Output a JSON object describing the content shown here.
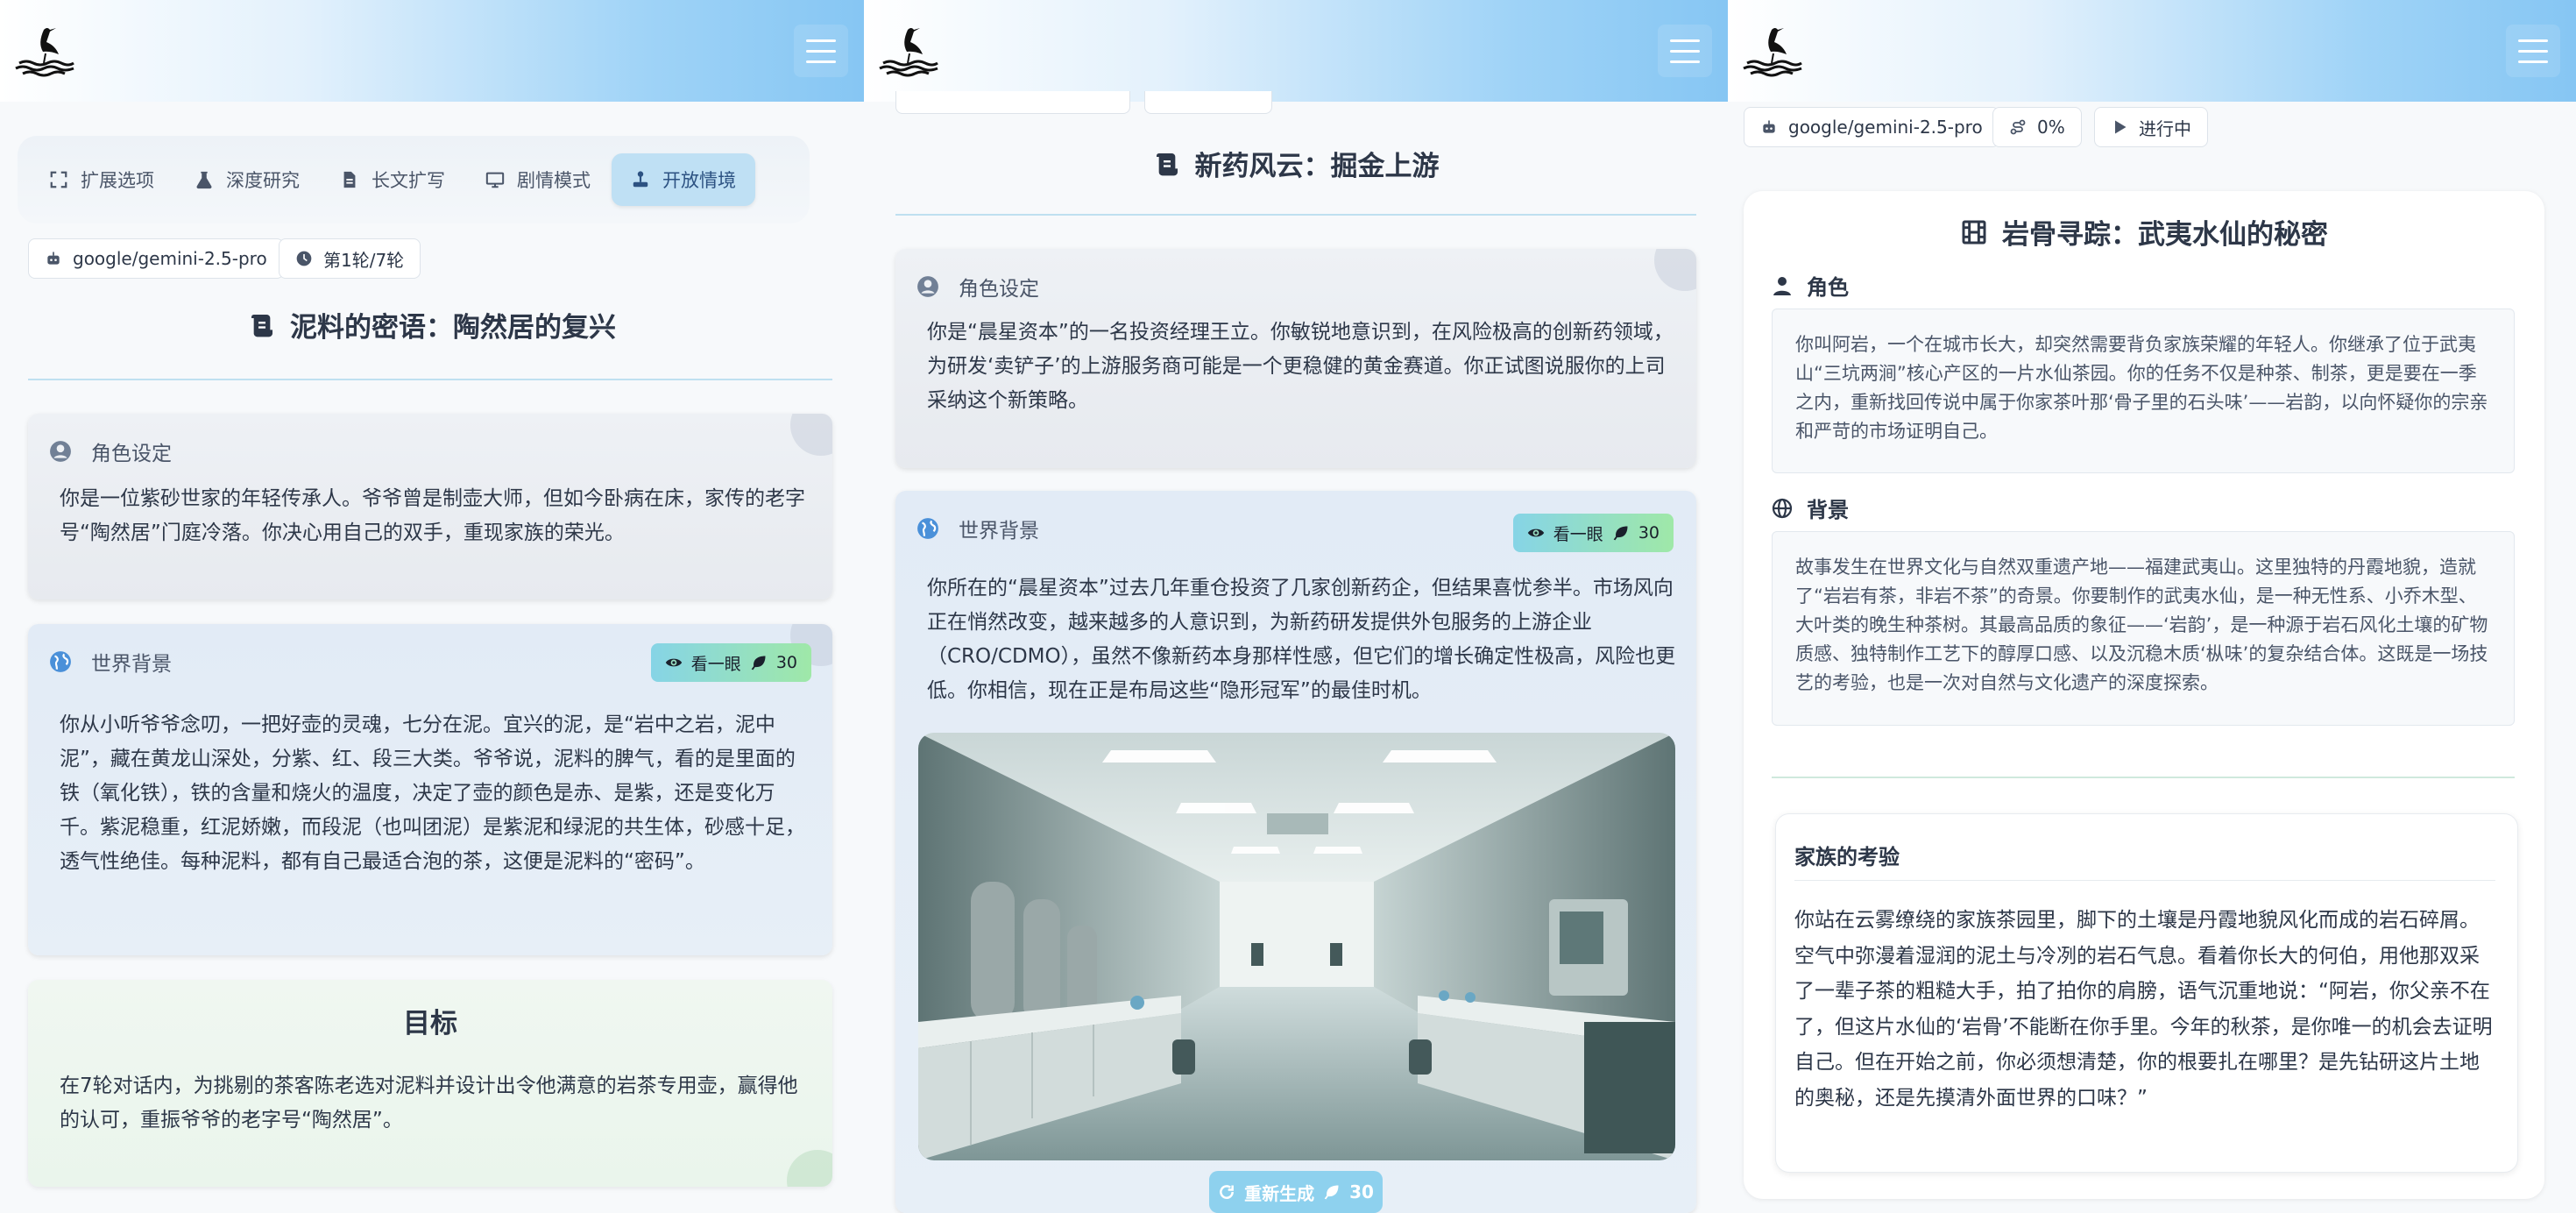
{
  "panels": [
    {
      "tabs": [
        {
          "label": "扩展选项",
          "icon": "expand-icon"
        },
        {
          "label": "深度研究",
          "icon": "flask-icon"
        },
        {
          "label": "长文扩写",
          "icon": "document-icon"
        },
        {
          "label": "剧情模式",
          "icon": "monitor-icon"
        },
        {
          "label": "开放情境",
          "icon": "joystick-icon",
          "active": true
        }
      ],
      "model": "google/gemini-2.5-pro",
      "rounds": "第1轮/7轮",
      "title": "泥料的密语：陶然居的复兴",
      "role": {
        "heading": "角色设定",
        "text": "你是一位紫砂世家的年轻传承人。爷爷曾是制壶大师，但如今卧病在床，家传的老字号“陶然居”门庭冷落。你决心用自己的双手，重现家族的荣光。"
      },
      "world": {
        "heading": "世界背景",
        "peek_label": "看一眼",
        "peek_cost": "30",
        "text": "你从小听爷爷念叨，一把好壶的灵魂，七分在泥。宜兴的泥，是“岩中之岩，泥中泥”，藏在黄龙山深处，分紫、红、段三大类。爷爷说，泥料的脾气，看的是里面的铁（氧化铁），铁的含量和烧火的温度，决定了壶的颜色是赤、是紫，还是变化万千。紫泥稳重，红泥娇嫩，而段泥（也叫团泥）是紫泥和绿泥的共生体，砂感十足，透气性绝佳。每种泥料，都有自己最适合泡的茶，这便是泥料的“密码”。"
      },
      "goal": {
        "heading": "目标",
        "text": "在7轮对话内，为挑剔的茶客陈老选对泥料并设计出令他满意的岩茶专用壶，赢得他的认可，重振爷爷的老字号“陶然居”。"
      }
    },
    {
      "title": "新药风云：掘金上游",
      "role": {
        "heading": "角色设定",
        "text": "你是“晨星资本”的一名投资经理王立。你敏锐地意识到，在风险极高的创新药领域，为研发‘卖铲子’的上游服务商可能是一个更稳健的黄金赛道。你正试图说服你的上司采纳这个新策略。"
      },
      "world": {
        "heading": "世界背景",
        "peek_label": "看一眼",
        "peek_cost": "30",
        "text": "你所在的“晨星资本”过去几年重仓投资了几家创新药企，但结果喜忧参半。市场风向正在悄然改变，越来越多的人意识到，为新药研发提供外包服务的上游企业（CRO/CDMO），虽然不像新药本身那样性感，但它们的增长确定性极高，风险也更低。你相信，现在正是布局这些“隐形冠军”的最佳时机。"
      },
      "regen_label": "重新生成",
      "regen_cost": "30"
    },
    {
      "model": "google/gemini-2.5-pro",
      "progress": "0%",
      "status": "进行中",
      "title": "岩骨寻踪：武夷水仙的秘密",
      "role": {
        "heading": "角色",
        "text": "你叫阿岩，一个在城市长大，却突然需要背负家族荣耀的年轻人。你继承了位于武夷山“三坑两涧”核心产区的一片水仙茶园。你的任务不仅是种茶、制茶，更是要在一季之内，重新找回传说中属于你家茶叶那‘骨子里的石头味’——岩韵，以向怀疑你的宗亲和严苛的市场证明自己。"
      },
      "world": {
        "heading": "背景",
        "text": "故事发生在世界文化与自然双重遗产地——福建武夷山。这里独特的丹霞地貌，造就了“岩岩有茶，非岩不茶”的奇景。你要制作的武夷水仙，是一种无性系、小乔木型、大叶类的晚生种茶树。其最高品质的象征——‘岩韵’，是一种源于岩石风化土壤的矿物质感、独特制作工艺下的醇厚口感、以及沉稳木质‘枞味’的复杂结合体。这既是一场技艺的考验，也是一次对自然与文化遗产的深度探索。"
      },
      "chapter": {
        "heading": "家族的考验",
        "text": "你站在云雾缭绕的家族茶园里，脚下的土壤是丹霞地貌风化而成的岩石碎屑。空气中弥漫着湿润的泥土与冷冽的岩石气息。看着你长大的何伯，用他那双采了一辈子茶的粗糙大手，拍了拍你的肩膀，语气沉重地说：“阿岩，你父亲不在了，但这片水仙的‘岩骨’不能断在你手里。今年的秋茶，是你唯一的机会去证明自己。但在开始之前，你必须想清楚，你的根要扎在哪里？是先钻研这片土地的奥秘，还是先摸清外面世界的口味？”"
      }
    }
  ],
  "colors": {
    "topbar_start": "#ffffff",
    "topbar_end": "#86c6f3",
    "active_tab": "#bfe0f4",
    "peek_gradient_start": "#86d4e6",
    "peek_gradient_end": "#9fe8a8",
    "regen": "#8ed1ee"
  }
}
